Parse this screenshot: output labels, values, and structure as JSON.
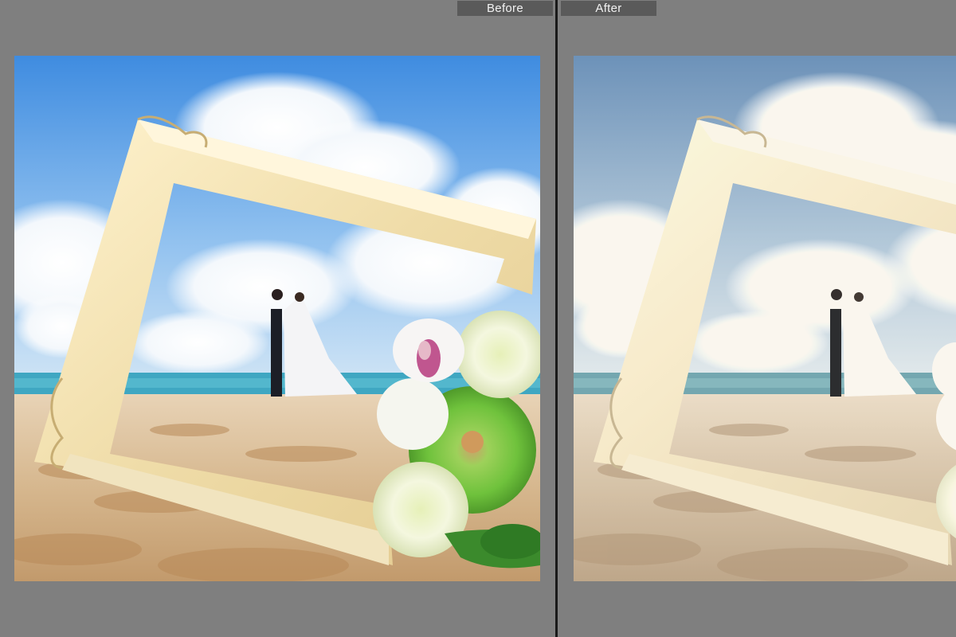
{
  "compare": {
    "before_label": "Before",
    "after_label": "After"
  },
  "colors": {
    "background": "#7f7f7f",
    "label_bg": "#5a5a5a",
    "divider": "#1a1a1a"
  },
  "photo": {
    "scene": "beach-wedding-frame-bouquet"
  }
}
